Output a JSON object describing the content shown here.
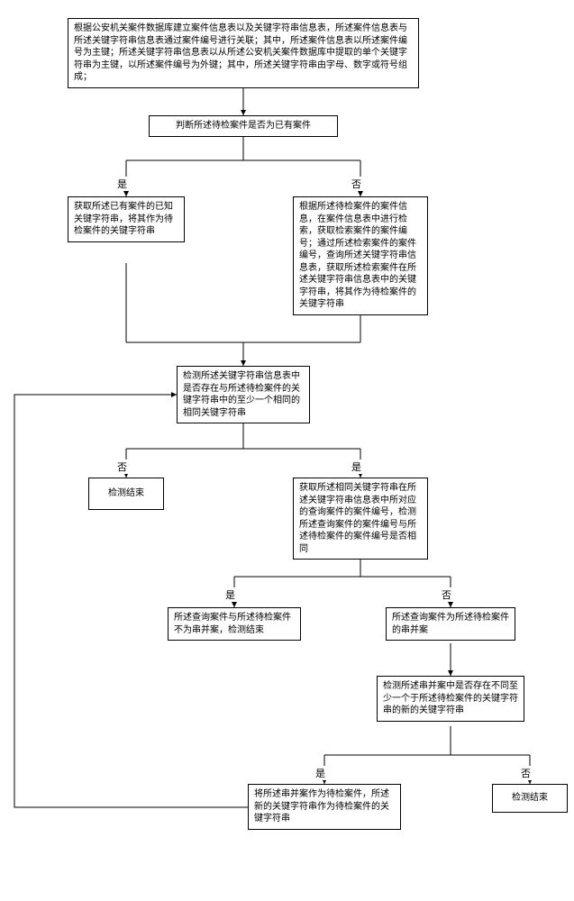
{
  "boxes": {
    "n1": "根据公安机关案件数据库建立案件信息表以及关键字符串信息表，所述案件信息表与所述关键字符串信息表通过案件编号进行关联；其中，所述案件信息表以所述案件编号为主键；所述关键字符串信息表以从所述公安机关案件数据库中提取的单个关键字符串为主键，以所述案件编号为外键；其中，所述关键字符串由字母、数字或符号组成；",
    "n2": "判断所述待检案件是否为已有案件",
    "n3": "获取所述已有案件的已知关键字符串，将其作为待检案件的关键字符串",
    "n4": "根据所述待检案件的案件信息，在案件信息表中进行检索，获取检索案件的案件编号；通过所述检索案件的案件编号，查询所述关键字符串信息表，获取所述检索案件在所述关键字符串信息表中的关键字符串，将其作为待检案件的关键字符串",
    "n5": "检测所述关键字符串信息表中是否存在与所述待检案件的关键字符串中的至少一个相同的相同关键字符串",
    "n6": "检测结束",
    "n7": "获取所述相同关键字符串在所述关键字符串信息表中所对应的查询案件的案件编号，检测所述查询案件的案件编号与所述待检案件的案件编号是否相同",
    "n8": "所述查询案件与所述待检案件不为串并案，检测结束",
    "n9": "所述查询案件为所述待检案件的串并案",
    "n10": "检测所述串并案中是否存在不同至少一个于所述待检案件的关键字符串的新的关键字符串",
    "n11": "将所述串并案作为待检案件，所述新的关键字符串作为待检案件的关键字符串",
    "n12": "检测结束"
  },
  "labels": {
    "yes": "是",
    "no": "否"
  }
}
